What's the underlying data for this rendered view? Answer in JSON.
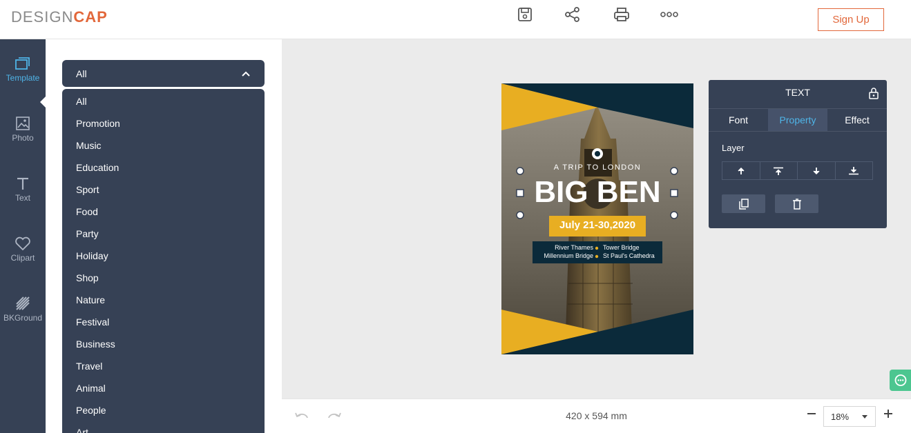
{
  "app": {
    "logo_design": "DESIGN",
    "logo_cap": "CAP",
    "signup": "Sign Up",
    "toolbar_icons": [
      "save-icon",
      "share-icon",
      "print-icon",
      "more-icon"
    ]
  },
  "rail": {
    "items": [
      {
        "label": "Template",
        "icon": "template-icon",
        "active": true
      },
      {
        "label": "Photo",
        "icon": "photo-icon"
      },
      {
        "label": "Text",
        "icon": "text-icon"
      },
      {
        "label": "Clipart",
        "icon": "heart-icon"
      },
      {
        "label": "BKGround",
        "icon": "background-icon"
      }
    ]
  },
  "panel": {
    "selected": "All",
    "options": [
      "All",
      "Promotion",
      "Music",
      "Education",
      "Sport",
      "Food",
      "Party",
      "Holiday",
      "Shop",
      "Nature",
      "Festival",
      "Business",
      "Travel",
      "Animal",
      "People",
      "Art"
    ]
  },
  "poster": {
    "subtitle": "A TRIP TO LONDON",
    "title": "BIG BEN",
    "date": "July 21-30,2020",
    "place1": "River Thames",
    "place2": "Tower Bridge",
    "place3": "Millennium Bridge",
    "place4": "St Paul's Cathedra"
  },
  "textpanel": {
    "title": "TEXT",
    "tabs": [
      "Font",
      "Property",
      "Effect"
    ],
    "active_tab": "Property",
    "layer_label": "Layer"
  },
  "footer": {
    "dimensions": "420 x 594 mm",
    "zoom": "18%"
  },
  "colors": {
    "accent": "#e2673a",
    "sidebar": "#364155",
    "highlight": "#4fb5e8",
    "poster_yellow": "#e8ae22",
    "poster_navy": "#0b2a3a"
  }
}
